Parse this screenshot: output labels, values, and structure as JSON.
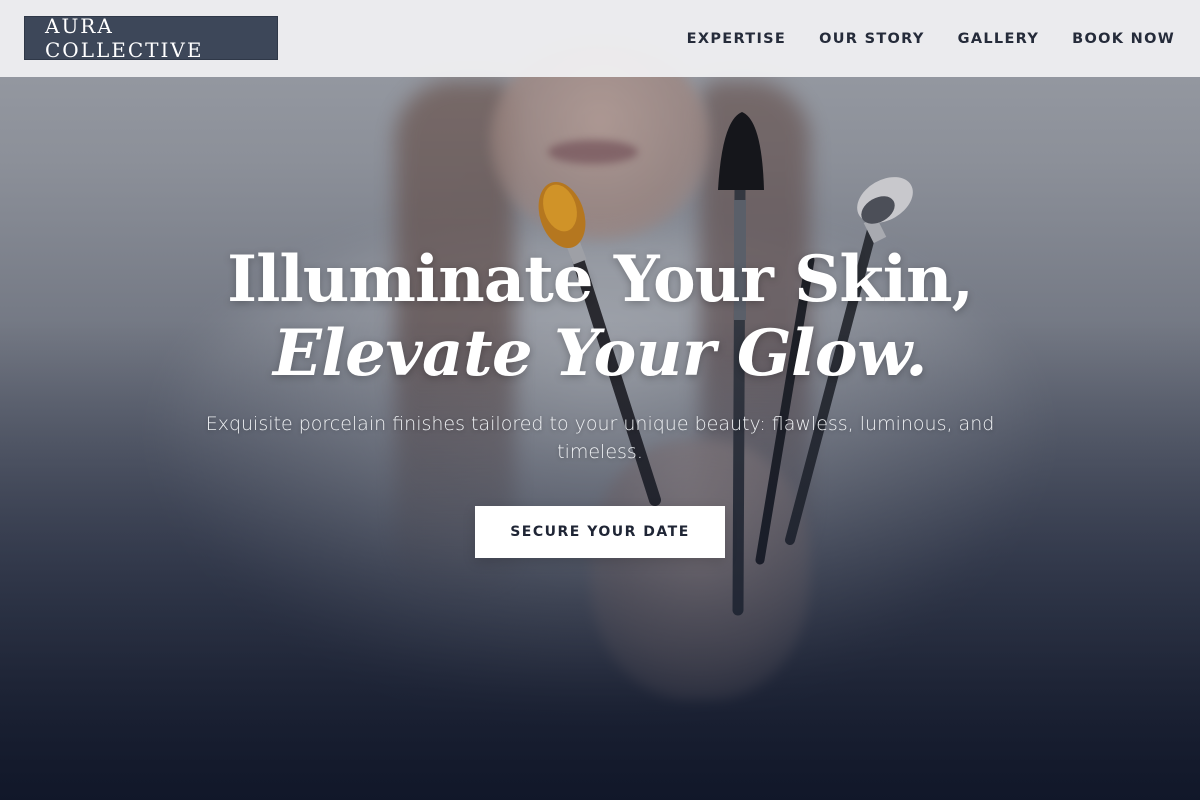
{
  "header": {
    "logo": "AURA COLLECTIVE",
    "nav": [
      {
        "label": "EXPERTISE"
      },
      {
        "label": "OUR STORY"
      },
      {
        "label": "GALLERY"
      },
      {
        "label": "BOOK NOW"
      }
    ]
  },
  "hero": {
    "headline_line1": "Illuminate Your Skin,",
    "headline_line2": "Elevate Your Glow.",
    "subtitle": "Exquisite porcelain finishes tailored to your unique beauty: flawless, luminous, and timeless.",
    "cta_label": "SECURE YOUR DATE",
    "background_image": "woman-holding-makeup-brushes"
  },
  "colors": {
    "logo_bg": "#3d4759",
    "nav_text": "#252b3a",
    "header_bg": "#f0f0f2",
    "cta_bg": "#ffffff",
    "cta_text": "#1f2535",
    "hero_dark": "#1a2036"
  }
}
